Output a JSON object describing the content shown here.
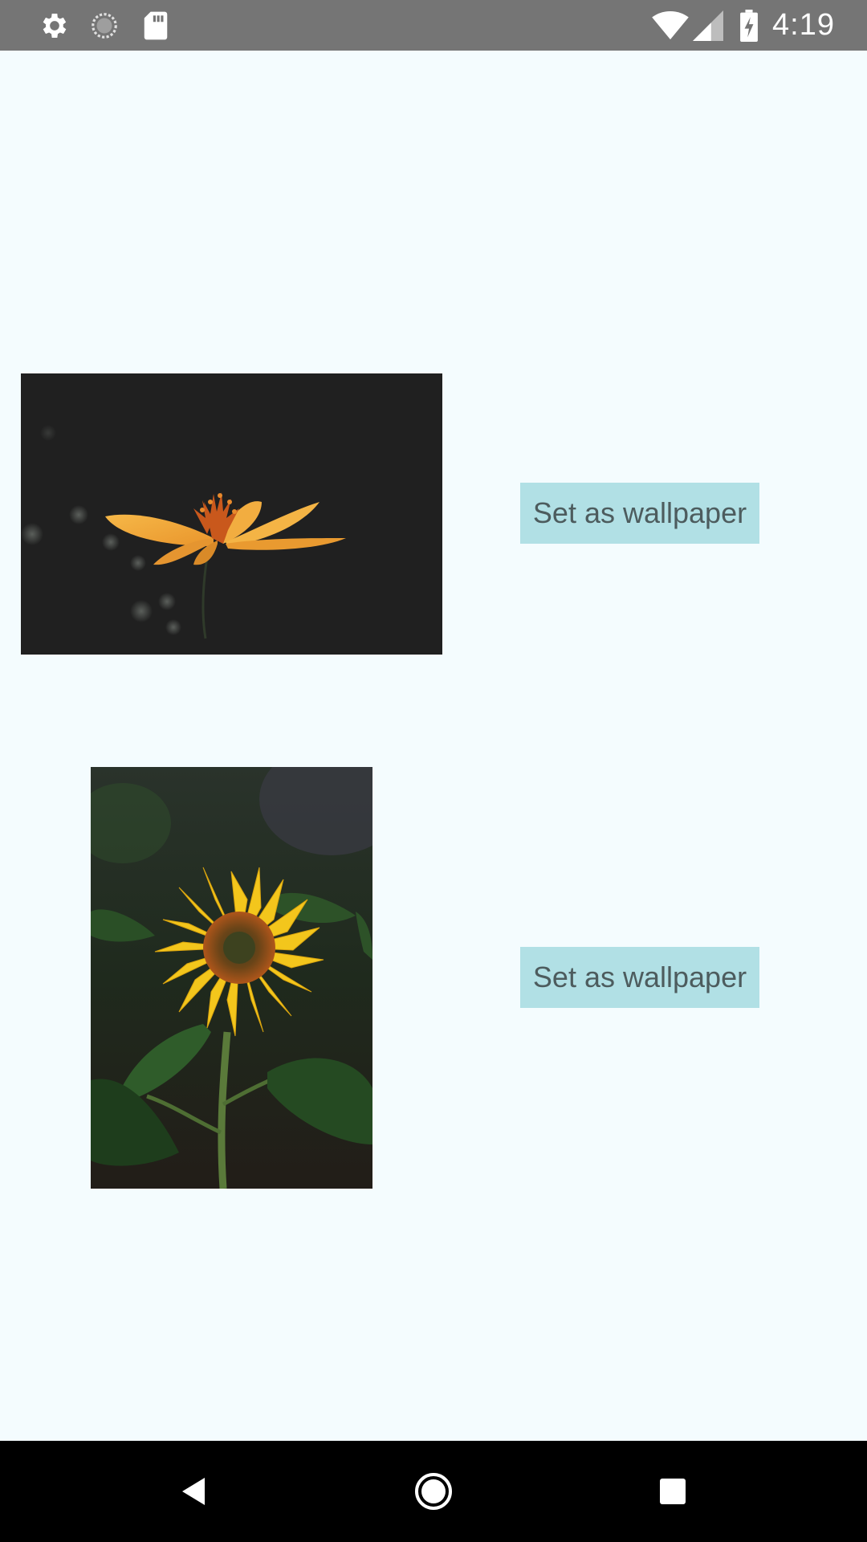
{
  "status_bar": {
    "time": "4:19",
    "icons": [
      "settings-icon",
      "sync-icon",
      "sd-card-icon",
      "wifi-icon",
      "signal-icon",
      "battery-charging-icon"
    ]
  },
  "wallpapers": [
    {
      "image": "cosmos-flower-photo",
      "button_label": "Set as wallpaper"
    },
    {
      "image": "sunflower-photo",
      "button_label": "Set as wallpaper"
    }
  ],
  "navigation_bar": {
    "icons": [
      "back-icon",
      "home-icon",
      "recents-icon"
    ]
  },
  "colors": {
    "status_bar": "#757575",
    "background": "#f4fcfe",
    "button_background": "#b1e0e5",
    "button_text": "#4d5c5e",
    "nav_bar": "#000000"
  }
}
